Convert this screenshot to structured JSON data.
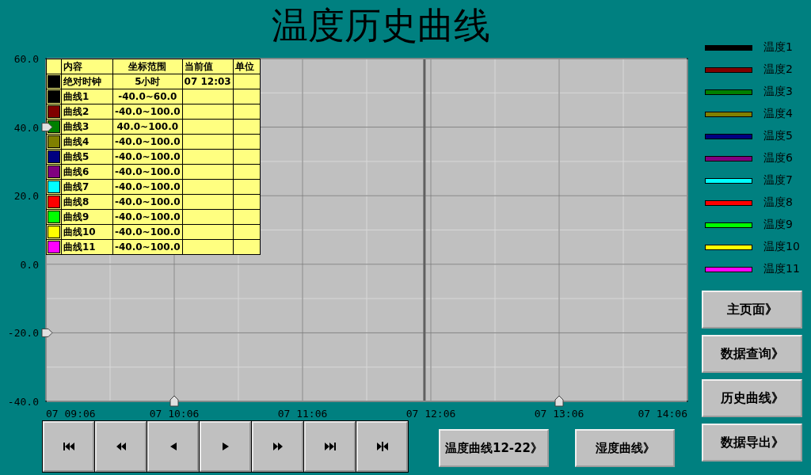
{
  "title": "温度历史曲线",
  "chart": {
    "chart_data": {
      "type": "line",
      "ylim": [
        -40,
        60
      ],
      "grid": true,
      "yticks": [
        {
          "value": 60,
          "label": "60.0"
        },
        {
          "value": 40,
          "label": "40.0"
        },
        {
          "value": 20,
          "label": "20.0"
        },
        {
          "value": 0,
          "label": "0.0"
        },
        {
          "value": -20,
          "label": "-20.0"
        },
        {
          "value": -40,
          "label": "-40.0"
        }
      ],
      "categories": [
        "07 09:06",
        "07 10:06",
        "07 11:06",
        "07 12:06",
        "07 13:06",
        "07 14:06"
      ]
    }
  },
  "table": {
    "columns": [
      "内容",
      "坐标范围",
      "当前值",
      "单位"
    ],
    "rows": [
      {
        "color": "#000000",
        "name": "绝对时钟",
        "range": "5小时",
        "value": "07 12:03"
      },
      {
        "color": "#000000",
        "name": "曲线1",
        "range": "-40.0~60.0"
      },
      {
        "color": "#800000",
        "name": "曲线2",
        "range": "-40.0~100.0"
      },
      {
        "color": "#008000",
        "name": "曲线3",
        "range": "40.0~100.0"
      },
      {
        "color": "#808000",
        "name": "曲线4",
        "range": "-40.0~100.0"
      },
      {
        "color": "#000080",
        "name": "曲线5",
        "range": "-40.0~100.0"
      },
      {
        "color": "#800080",
        "name": "曲线6",
        "range": "-40.0~100.0"
      },
      {
        "color": "#00ffff",
        "name": "曲线7",
        "range": "-40.0~100.0"
      },
      {
        "color": "#ff0000",
        "name": "曲线8",
        "range": "-40.0~100.0"
      },
      {
        "color": "#00ff00",
        "name": "曲线9",
        "range": "-40.0~100.0"
      },
      {
        "color": "#ffff00",
        "name": "曲线10",
        "range": "-40.0~100.0"
      },
      {
        "color": "#ff00ff",
        "name": "曲线11",
        "range": "-40.0~100.0"
      }
    ]
  },
  "legend": [
    {
      "label": "温度1",
      "color": "#000000"
    },
    {
      "label": "温度2",
      "color": "#800000"
    },
    {
      "label": "温度3",
      "color": "#008000"
    },
    {
      "label": "温度4",
      "color": "#808000"
    },
    {
      "label": "温度5",
      "color": "#000080"
    },
    {
      "label": "温度6",
      "color": "#800080"
    },
    {
      "label": "温度7",
      "color": "#00ffff"
    },
    {
      "label": "温度8",
      "color": "#ff0000"
    },
    {
      "label": "温度9",
      "color": "#00ff00"
    },
    {
      "label": "温度10",
      "color": "#ffff00"
    },
    {
      "label": "温度11",
      "color": "#ff00ff"
    }
  ],
  "bottom_buttons": [
    "温度曲线12-22》",
    "湿度曲线》"
  ],
  "nav_buttons": [
    "主页面》",
    "数据查询》",
    "历史曲线》",
    "数据导出》"
  ]
}
